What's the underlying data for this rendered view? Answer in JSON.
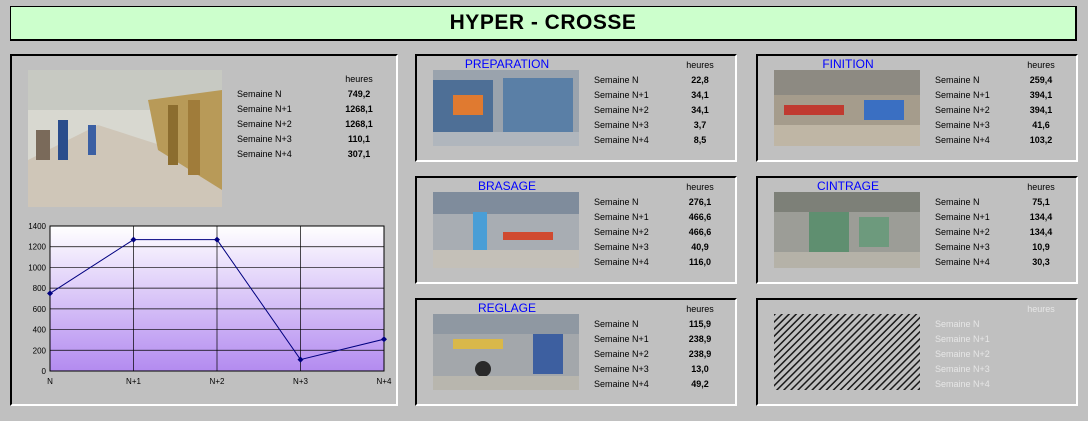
{
  "title": "HYPER - CROSSE",
  "overview": {
    "header": "heures",
    "rows": [
      {
        "label": "Semaine N",
        "value": "749,2"
      },
      {
        "label": "Semaine N+1",
        "value": "1268,1"
      },
      {
        "label": "Semaine N+2",
        "value": "1268,1"
      },
      {
        "label": "Semaine N+3",
        "value": "110,1"
      },
      {
        "label": "Semaine N+4",
        "value": "307,1"
      }
    ]
  },
  "sections": [
    {
      "name": "PREPARATION",
      "header": "heures",
      "rows": [
        {
          "label": "Semaine N",
          "value": "22,8"
        },
        {
          "label": "Semaine N+1",
          "value": "34,1"
        },
        {
          "label": "Semaine N+2",
          "value": "34,1"
        },
        {
          "label": "Semaine N+3",
          "value": "3,7"
        },
        {
          "label": "Semaine N+4",
          "value": "8,5"
        }
      ]
    },
    {
      "name": "FINITION",
      "header": "heures",
      "rows": [
        {
          "label": "Semaine N",
          "value": "259,4"
        },
        {
          "label": "Semaine N+1",
          "value": "394,1"
        },
        {
          "label": "Semaine N+2",
          "value": "394,1"
        },
        {
          "label": "Semaine N+3",
          "value": "41,6"
        },
        {
          "label": "Semaine N+4",
          "value": "103,2"
        }
      ]
    },
    {
      "name": "BRASAGE",
      "header": "heures",
      "rows": [
        {
          "label": "Semaine N",
          "value": "276,1"
        },
        {
          "label": "Semaine N+1",
          "value": "466,6"
        },
        {
          "label": "Semaine N+2",
          "value": "466,6"
        },
        {
          "label": "Semaine N+3",
          "value": "40,9"
        },
        {
          "label": "Semaine N+4",
          "value": "116,0"
        }
      ]
    },
    {
      "name": "CINTRAGE",
      "header": "heures",
      "rows": [
        {
          "label": "Semaine N",
          "value": "75,1"
        },
        {
          "label": "Semaine N+1",
          "value": "134,4"
        },
        {
          "label": "Semaine N+2",
          "value": "134,4"
        },
        {
          "label": "Semaine N+3",
          "value": "10,9"
        },
        {
          "label": "Semaine N+4",
          "value": "30,3"
        }
      ]
    },
    {
      "name": "REGLAGE",
      "header": "heures",
      "rows": [
        {
          "label": "Semaine N",
          "value": "115,9"
        },
        {
          "label": "Semaine N+1",
          "value": "238,9"
        },
        {
          "label": "Semaine N+2",
          "value": "238,9"
        },
        {
          "label": "Semaine N+3",
          "value": "13,0"
        },
        {
          "label": "Semaine N+4",
          "value": "49,2"
        }
      ]
    }
  ],
  "empty_section": {
    "header": "heures",
    "labels": [
      "Semaine N",
      "Semaine N+1",
      "Semaine N+2",
      "Semaine N+3",
      "Semaine N+4"
    ]
  },
  "colors": {
    "title_bg": "#ccffcc",
    "section_title": "#0000ff",
    "line": "#000080",
    "plot_gradient_top": "#ffffff",
    "plot_gradient_bottom": "#b38bf0"
  },
  "chart_data": {
    "type": "line",
    "categories": [
      "N",
      "N+1",
      "N+2",
      "N+3",
      "N+4"
    ],
    "values": [
      749.2,
      1268.1,
      1268.1,
      110.1,
      307.1
    ],
    "ylim": [
      0,
      1400
    ],
    "yticks": [
      "0",
      "200",
      "400",
      "600",
      "800",
      "1000",
      "1200",
      "1400"
    ],
    "grid": true,
    "title": "",
    "xlabel": "",
    "ylabel": ""
  }
}
